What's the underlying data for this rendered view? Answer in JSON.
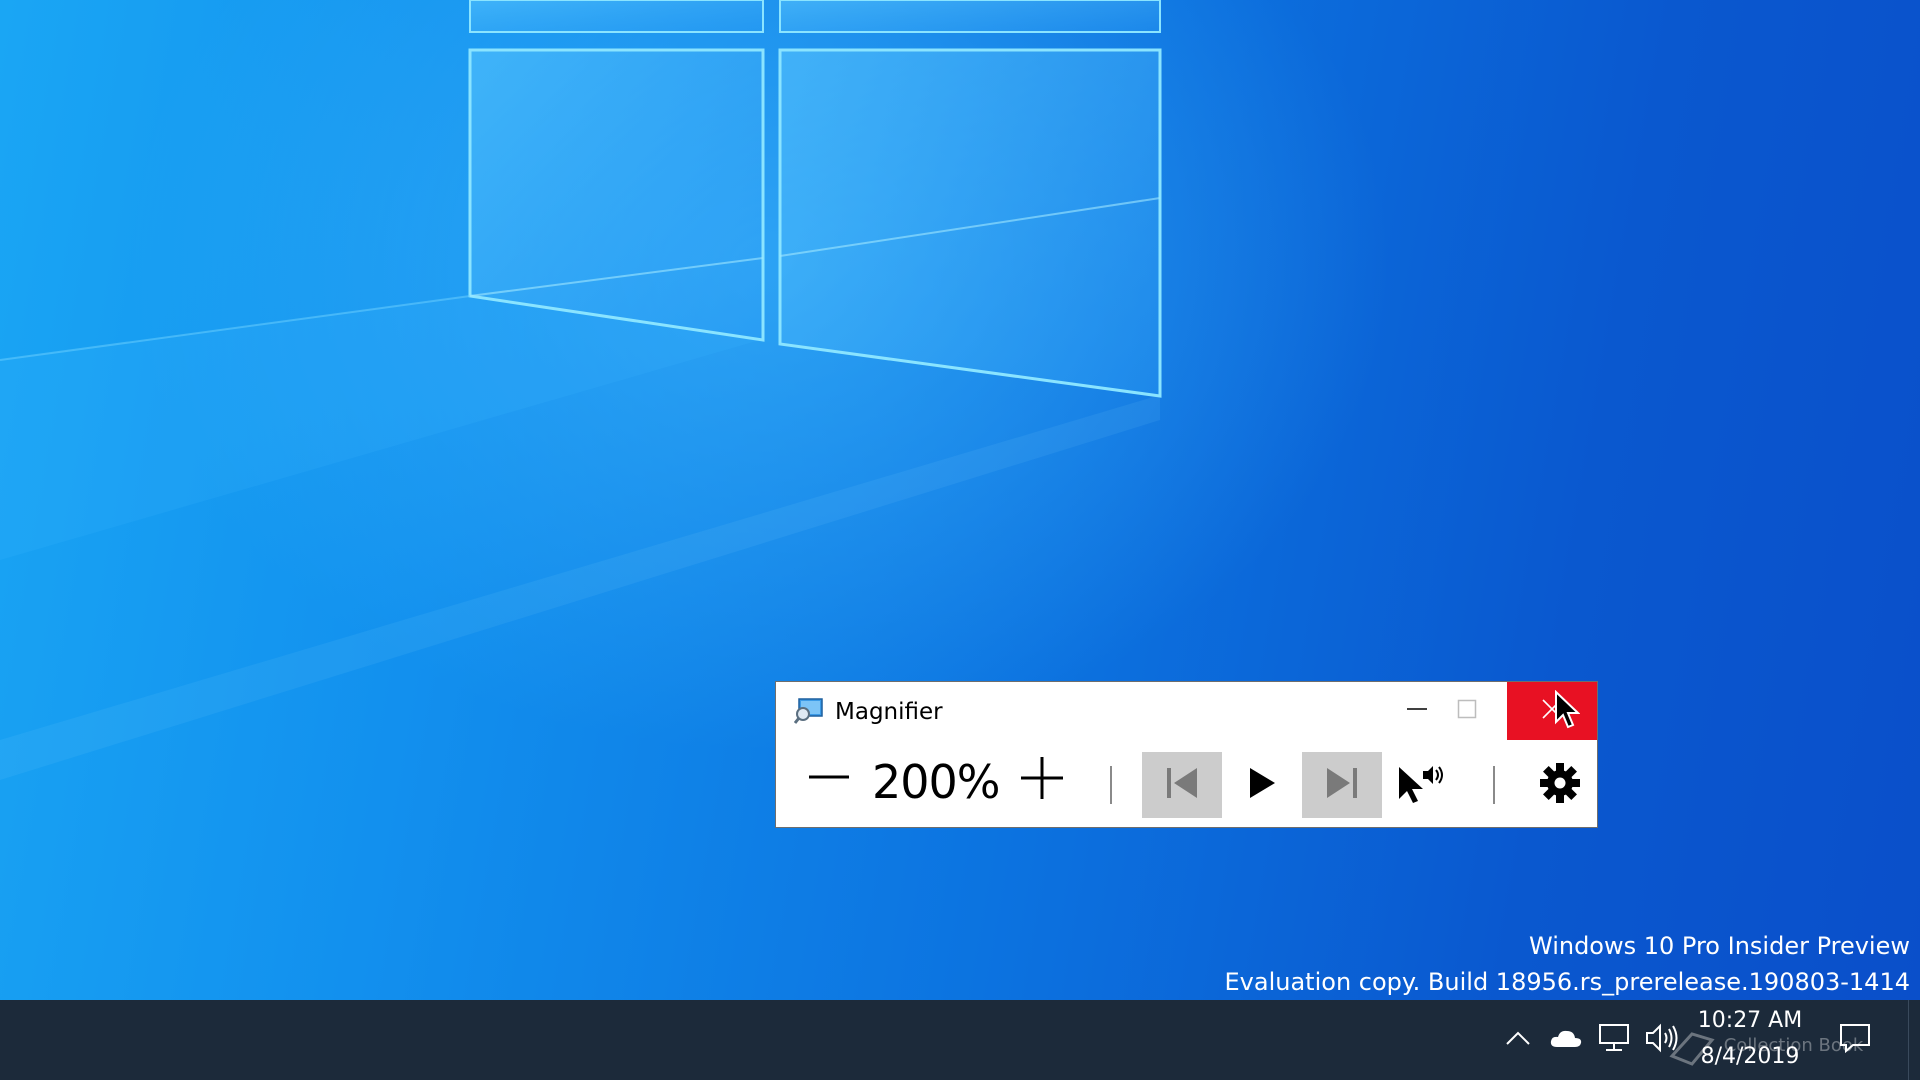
{
  "desktop": {
    "watermark_line1": "Windows 10 Pro Insider Preview",
    "watermark_line2": "Evaluation copy. Build 18956.rs_prerelease.190803-1414"
  },
  "magnifier": {
    "title": "Magnifier",
    "zoom_level": "200%",
    "icons": {
      "app": "magnifier-app-icon",
      "minimize": "minimize-icon",
      "maximize": "maximize-icon",
      "close": "close-icon",
      "zoom_out": "minus-icon",
      "zoom_in": "plus-icon",
      "previous": "skip-previous-icon",
      "play": "play-icon",
      "next": "skip-next-icon",
      "read_from_here": "pointer-speaker-icon",
      "settings": "gear-icon"
    },
    "colors": {
      "close_hover": "#e81123",
      "disabled_button": "#cccccc"
    }
  },
  "taskbar": {
    "clock_time": "10:27 AM",
    "clock_date": "8/4/2019",
    "overlay_text": "Collection Book",
    "tray_icons": [
      "chevron-up-icon",
      "onedrive-cloud-icon",
      "network-icon",
      "volume-icon"
    ],
    "notification_icon": "action-center-icon",
    "background": "#1c2a3a"
  }
}
